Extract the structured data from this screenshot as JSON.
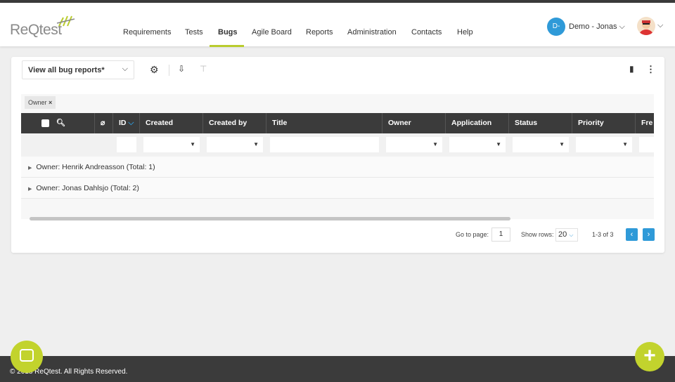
{
  "app": {
    "logo": "ReQtest"
  },
  "nav": {
    "items": [
      "Requirements",
      "Tests",
      "Bugs",
      "Agile Board",
      "Reports",
      "Administration",
      "Contacts",
      "Help"
    ],
    "active": "Bugs"
  },
  "account": {
    "initials": "D-",
    "name": "Demo - Jonas"
  },
  "toolbar": {
    "view_select": "View all bug reports*"
  },
  "grouping": {
    "chip": "Owner",
    "chip_close": "×"
  },
  "table": {
    "columns": [
      "ID",
      "Created",
      "Created by",
      "Title",
      "Owner",
      "Application",
      "Status",
      "Priority",
      "Fre"
    ],
    "groups": [
      "Owner: Henrik Andreasson (Total: 1)",
      "Owner: Jonas Dahlsjo (Total: 2)"
    ]
  },
  "pagination": {
    "go_to_label": "Go to page:",
    "page": "1",
    "rows_label": "Show rows:",
    "rows": "20",
    "range": "1-3 of 3",
    "prev": "‹",
    "next": "›"
  },
  "footer": {
    "copyright": "© 2018 ReQtest. All Rights Reserved."
  },
  "colors": {
    "accent": "#b9cc2e",
    "blue": "#2f9ad8",
    "dark": "#3b3b3b"
  }
}
